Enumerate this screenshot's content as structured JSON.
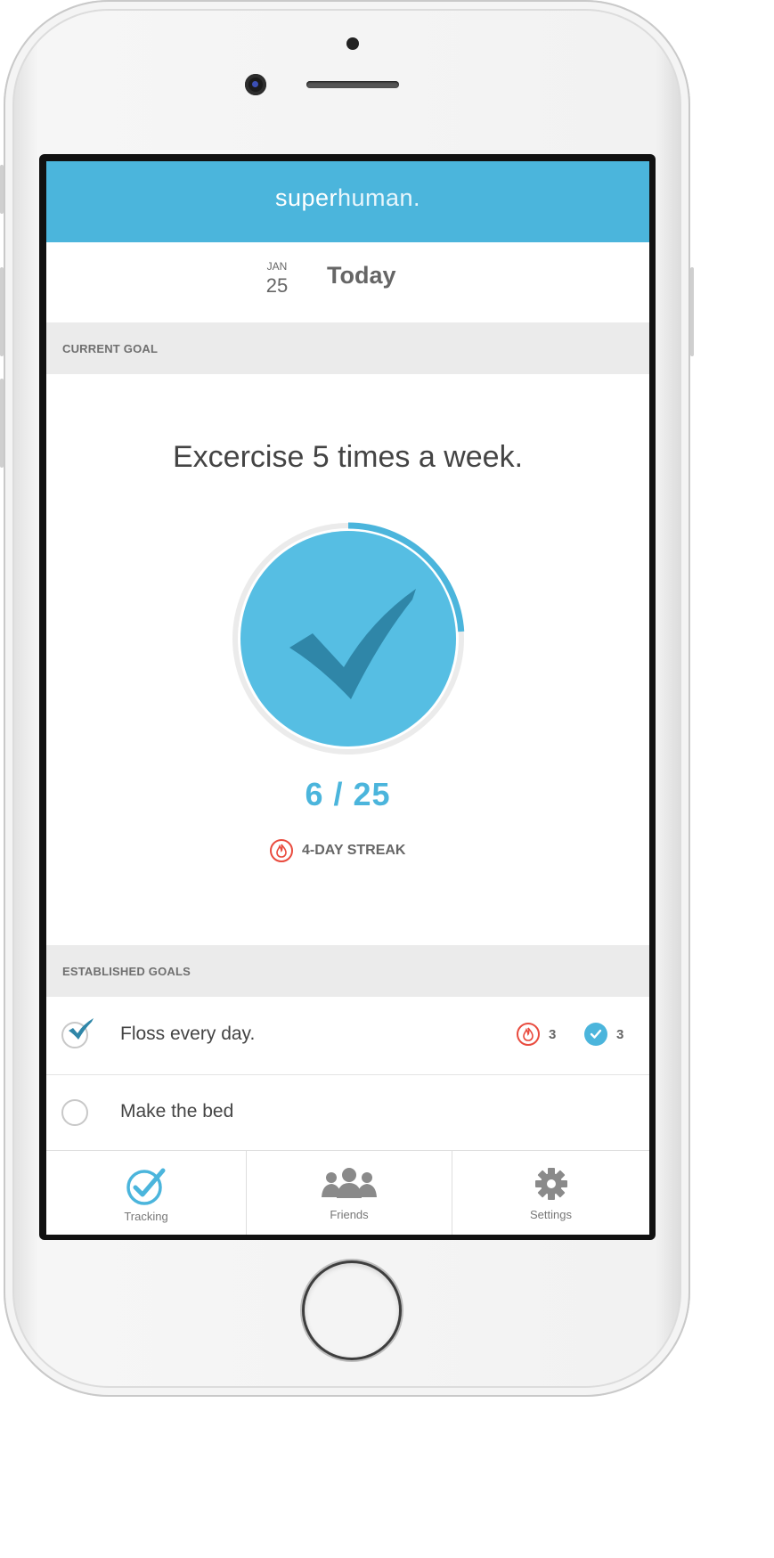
{
  "app": {
    "logo_bold": "super",
    "logo_light": "human."
  },
  "date": {
    "month": "JAN",
    "day": "25",
    "title": "Today"
  },
  "current_goal": {
    "section_label": "CURRENT GOAL",
    "text": "Excercise 5 times a week.",
    "progress_text": "6 / 25",
    "progress_fraction": 0.24,
    "streak_text": "4-DAY STREAK"
  },
  "established_goals": {
    "section_label": "ESTABLISHED GOALS",
    "items": [
      {
        "name": "Floss every day.",
        "checked": true,
        "streak": "3",
        "completed": "3"
      },
      {
        "name": "Make the bed",
        "checked": false
      }
    ]
  },
  "tabs": [
    {
      "label": "Tracking",
      "icon": "check-circle-icon",
      "active": true
    },
    {
      "label": "Friends",
      "icon": "friends-icon",
      "active": false
    },
    {
      "label": "Settings",
      "icon": "gear-icon",
      "active": false
    }
  ],
  "colors": {
    "accent": "#4bb5dc",
    "checkmark_dark": "#2f86a8",
    "streak_red": "#e94b3e"
  }
}
